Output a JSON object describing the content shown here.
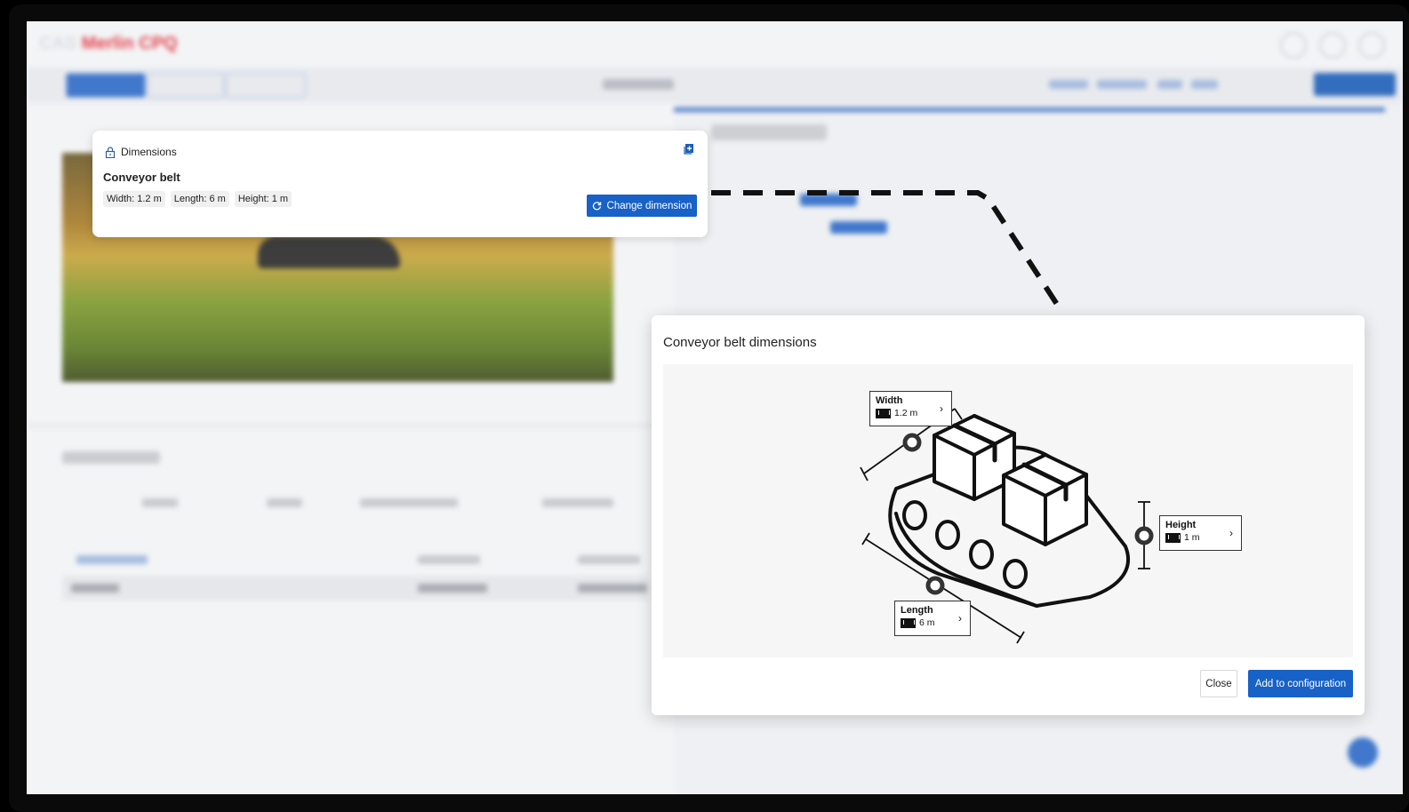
{
  "dimensions_card": {
    "header": "Dimensions",
    "title": "Conveyor belt",
    "width_chip": "Width: 1.2 m",
    "length_chip": "Length: 6 m",
    "height_chip": "Height: 1 m",
    "change_button": "Change dimension"
  },
  "modal": {
    "title": "Conveyor belt dimensions",
    "width_tag": {
      "label": "Width",
      "value": "1.2 m"
    },
    "length_tag": {
      "label": "Length",
      "value": "6 m"
    },
    "height_tag": {
      "label": "Height",
      "value": "1 m"
    },
    "close_button": "Close",
    "add_button": "Add to configuration"
  },
  "colors": {
    "accent": "#1761c7",
    "brand_red": "#e0303a"
  },
  "icons": [
    "lock-icon",
    "expand-icon",
    "refresh-icon",
    "ruler-icon",
    "chevron-right-icon"
  ]
}
